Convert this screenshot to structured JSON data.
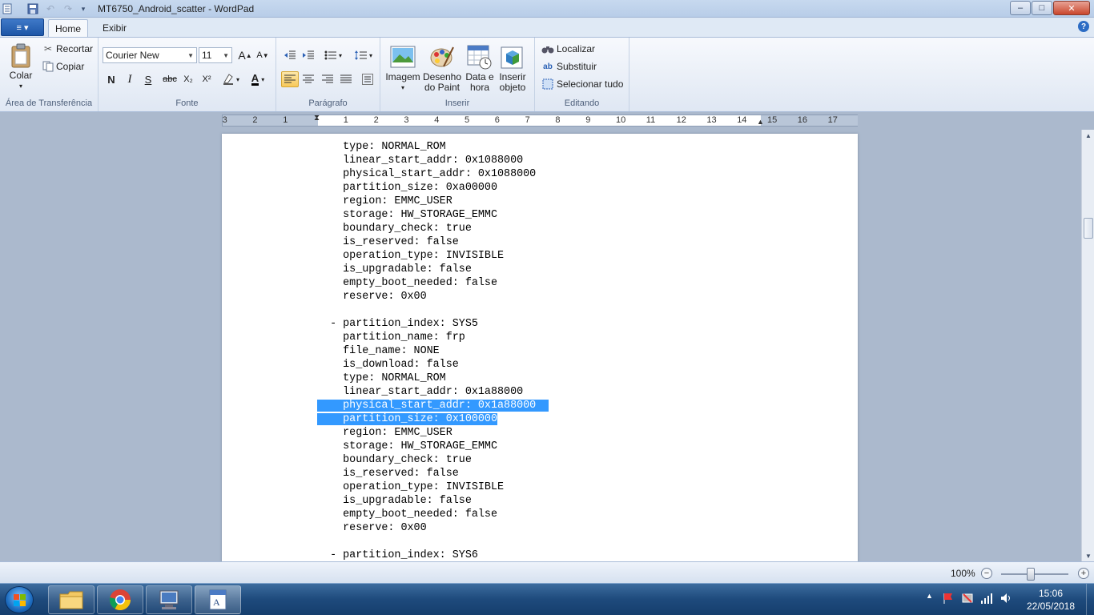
{
  "window": {
    "title": "MT6750_Android_scatter - WordPad",
    "buttons": {
      "minimize": "–",
      "maximize": "□",
      "close": "✕"
    }
  },
  "tabs": {
    "file_menu": "≡ ▾",
    "home": "Home",
    "view": "Exibir",
    "help": "?"
  },
  "ribbon": {
    "clipboard": {
      "label": "Área de Transferência",
      "paste": "Colar",
      "cut": "Recortar",
      "copy": "Copiar"
    },
    "font": {
      "label": "Fonte",
      "family": "Courier New",
      "size": "11",
      "grow": "A",
      "shrink": "A",
      "bold": "N",
      "italic": "I",
      "underline": "S",
      "strike": "abc",
      "subscript": "X₂",
      "superscript": "X²",
      "color": "A"
    },
    "paragraph": {
      "label": "Parágrafo"
    },
    "insert": {
      "label": "Inserir",
      "image": "Imagem",
      "paint_line1": "Desenho",
      "paint_line2": "do Paint",
      "datetime_line1": "Data e",
      "datetime_line2": "hora",
      "object_line1": "Inserir",
      "object_line2": "objeto"
    },
    "editing": {
      "label": "Editando",
      "find": "Localizar",
      "replace": "Substituir",
      "select_all": "Selecionar tudo"
    }
  },
  "ruler": {
    "ticks": [
      "3",
      "2",
      "1",
      "1",
      "2",
      "3",
      "4",
      "5",
      "6",
      "7",
      "8",
      "9",
      "10",
      "11",
      "12",
      "13",
      "14",
      "15",
      "16",
      "17"
    ]
  },
  "document": {
    "lines": [
      {
        "text": "    type: NORMAL_ROM",
        "selected": false
      },
      {
        "text": "    linear_start_addr: 0x1088000",
        "selected": false
      },
      {
        "text": "    physical_start_addr: 0x1088000",
        "selected": false
      },
      {
        "text": "    partition_size: 0xa00000",
        "selected": false
      },
      {
        "text": "    region: EMMC_USER",
        "selected": false
      },
      {
        "text": "    storage: HW_STORAGE_EMMC",
        "selected": false
      },
      {
        "text": "    boundary_check: true",
        "selected": false
      },
      {
        "text": "    is_reserved: false",
        "selected": false
      },
      {
        "text": "    operation_type: INVISIBLE",
        "selected": false
      },
      {
        "text": "    is_upgradable: false",
        "selected": false
      },
      {
        "text": "    empty_boot_needed: false",
        "selected": false
      },
      {
        "text": "    reserve: 0x00",
        "selected": false
      },
      {
        "text": "",
        "selected": false
      },
      {
        "text": "  - partition_index: SYS5",
        "selected": false
      },
      {
        "text": "    partition_name: frp",
        "selected": false
      },
      {
        "text": "    file_name: NONE",
        "selected": false
      },
      {
        "text": "    is_download: false",
        "selected": false
      },
      {
        "text": "    type: NORMAL_ROM",
        "selected": false
      },
      {
        "text": "    linear_start_addr: 0x1a88000",
        "selected": false
      },
      {
        "text": "    physical_start_addr: 0x1a88000  ",
        "selected": true
      },
      {
        "text": "    partition_size: 0x100000",
        "selected": true
      },
      {
        "text": "    region: EMMC_USER",
        "selected": false
      },
      {
        "text": "    storage: HW_STORAGE_EMMC",
        "selected": false
      },
      {
        "text": "    boundary_check: true",
        "selected": false
      },
      {
        "text": "    is_reserved: false",
        "selected": false
      },
      {
        "text": "    operation_type: INVISIBLE",
        "selected": false
      },
      {
        "text": "    is_upgradable: false",
        "selected": false
      },
      {
        "text": "    empty_boot_needed: false",
        "selected": false
      },
      {
        "text": "    reserve: 0x00",
        "selected": false
      },
      {
        "text": "",
        "selected": false
      },
      {
        "text": "  - partition_index: SYS6",
        "selected": false
      }
    ]
  },
  "statusbar": {
    "zoom": "100%",
    "zoom_out": "−",
    "zoom_in": "+",
    "zoom_level_percent": 100
  },
  "taskbar": {
    "clock_time": "15:06",
    "clock_date": "22/05/2018"
  },
  "colors": {
    "selection": "#3399ff",
    "accent": "#1d56a7"
  }
}
